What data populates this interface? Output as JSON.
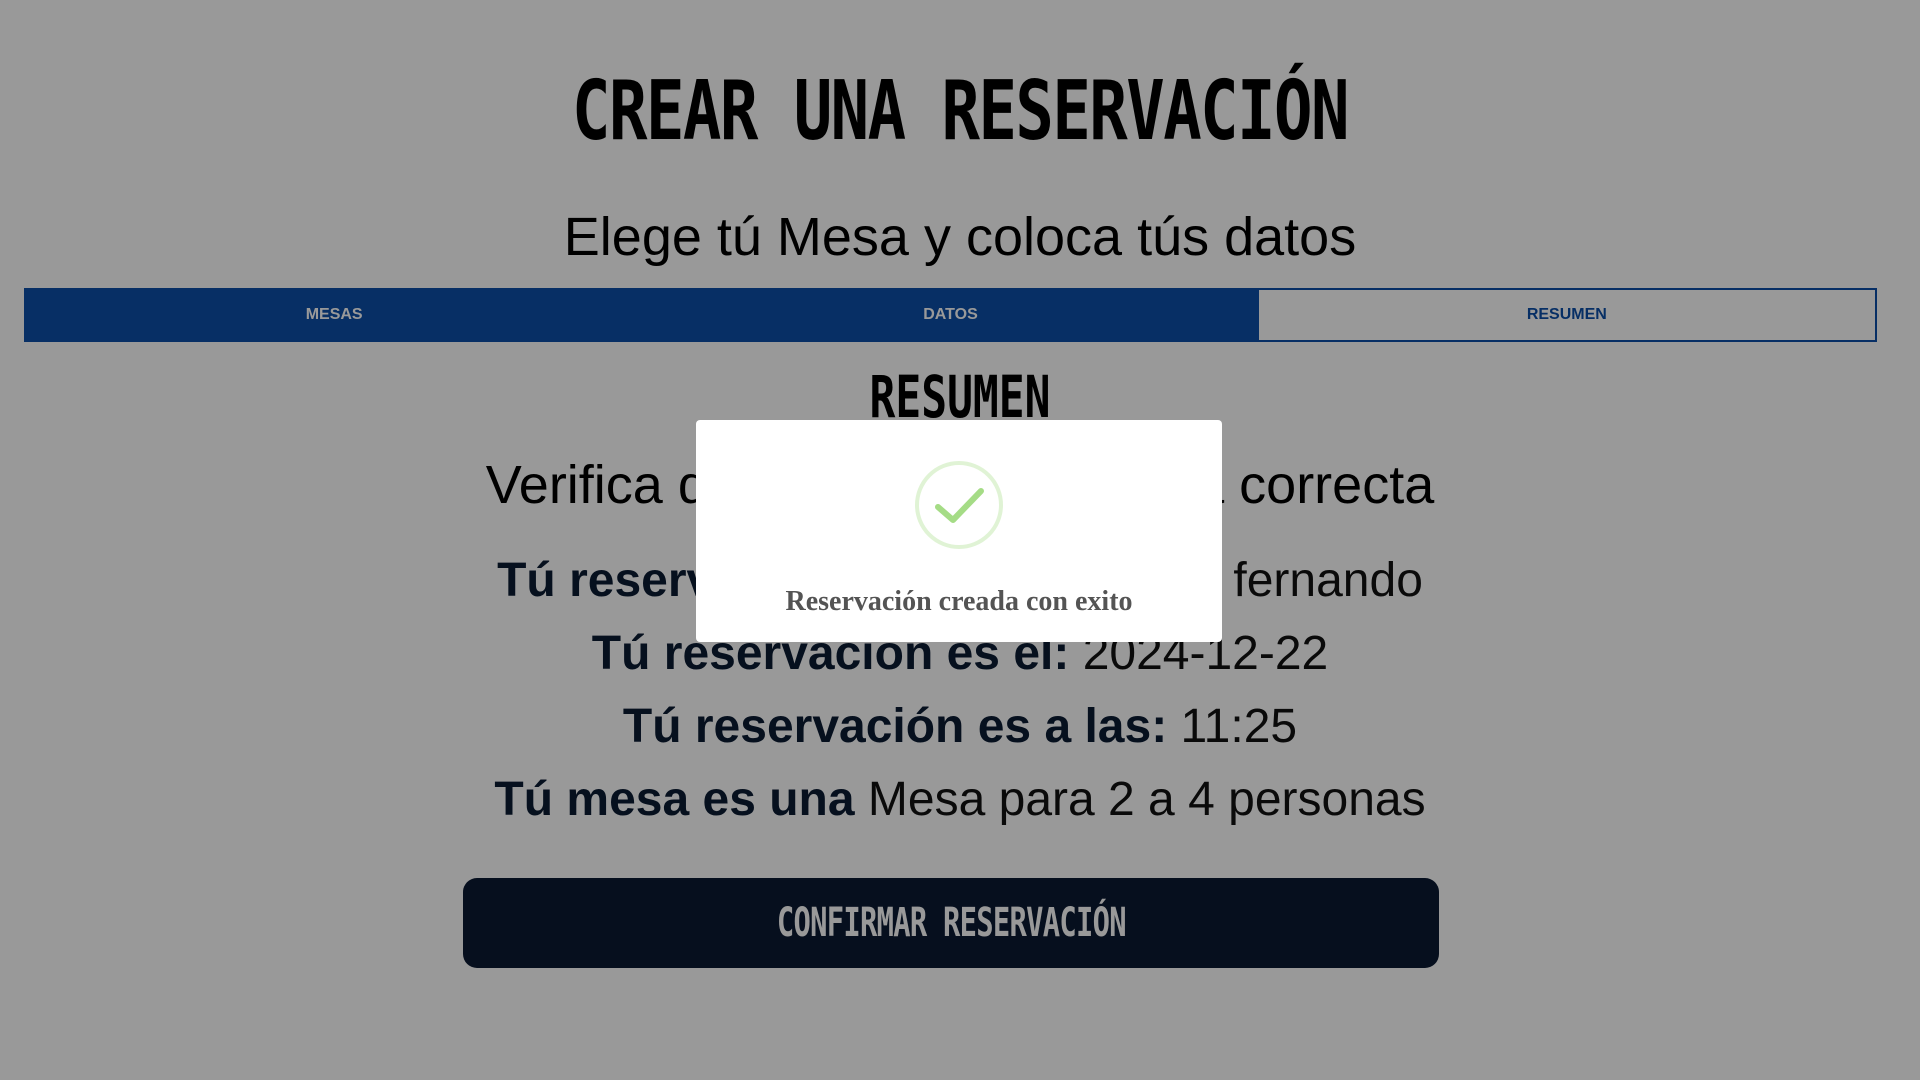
{
  "header": {
    "title": "CREAR UNA RESERVACIÓN",
    "subtitle": "Elege tú Mesa y coloca tús datos"
  },
  "steps": [
    {
      "label": "MESAS",
      "state": "done"
    },
    {
      "label": "DATOS",
      "state": "done"
    },
    {
      "label": "RESUMEN",
      "state": "current"
    }
  ],
  "summary": {
    "title": "RESUMEN",
    "verify_text": "Verifica que tú información sea correcta",
    "name_label": "Tú reservación es a nombre de:",
    "name_value": "fernando",
    "date_label": "Tú reservación es el:",
    "date_value": "2024-12-22",
    "time_label": "Tú reservación es a las:",
    "time_value": "11:25",
    "table_label": "Tú mesa es una",
    "table_value": "Mesa para 2 a 4 personas"
  },
  "confirm_button": {
    "label": "CONFIRMAR RESERVACIÓN"
  },
  "modal": {
    "message": "Reservación creada con exito",
    "icon": "success-check-icon"
  },
  "colors": {
    "accent_blue": "#0d4fa8",
    "button_dark": "#0b1a33",
    "success_green": "#a5dc86",
    "overlay": "rgba(0,0,0,0.4)"
  }
}
